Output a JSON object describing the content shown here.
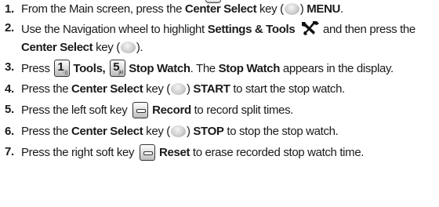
{
  "steps": [
    {
      "num": "1.",
      "a": "From the Main screen, press the ",
      "b1": "Center Select",
      "c": " key (",
      "d": ") ",
      "b2": "MENU",
      "e": "."
    },
    {
      "num": "2.",
      "a": "Use the Navigation wheel to highlight ",
      "b1": "Settings & Tools",
      "c": " and then press the ",
      "b2": "Center Select",
      "d": " key (",
      "e": ")."
    },
    {
      "num": "3.",
      "a": "Press ",
      "b1": "Tools,",
      "b2": "Stop Watch",
      "c": ". The ",
      "b3": "Stop Watch",
      "d": " appears in the display."
    },
    {
      "num": "4.",
      "a": "Press the ",
      "b1": "Center Select",
      "c": " key (",
      "d": ") ",
      "b2": "START",
      "e": " to start the stop watch."
    },
    {
      "num": "5.",
      "a": "Press the left soft key ",
      "b1": "Record",
      "c": " to record split times."
    },
    {
      "num": "6.",
      "a": "Press the ",
      "b1": "Center Select",
      "c": " key (",
      "d": ") ",
      "b2": "STOP",
      "e": " to stop the stop watch."
    },
    {
      "num": "7.",
      "a": "Press the right soft key ",
      "b1": "Reset",
      "c": " to erase recorded stop watch time."
    }
  ],
  "keys": {
    "tools_key": {
      "digit": "1",
      "sub": "◦))"
    },
    "stopwatch_key": {
      "digit": "5",
      "sub": "jkl"
    }
  },
  "icons": {
    "center_select": "center-select-key-icon",
    "settings_tools": "wrench-screwdriver-icon",
    "soft_key": "soft-key-icon"
  }
}
